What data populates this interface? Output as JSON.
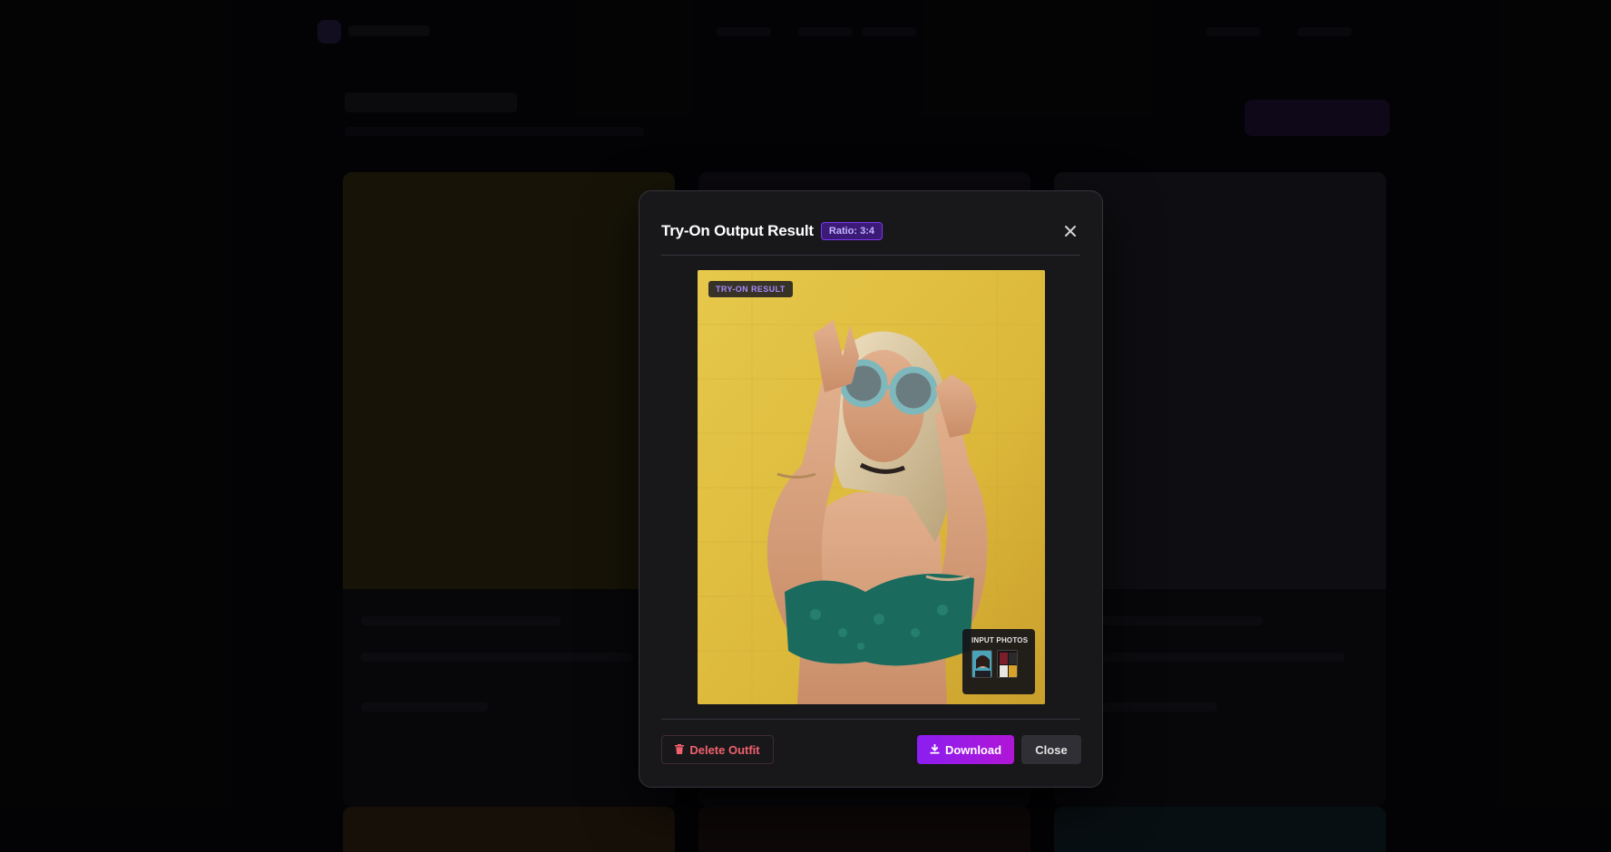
{
  "modal": {
    "title": "Try-On Output Result",
    "ratio_badge": "Ratio: 3:4",
    "close_icon": "close-icon",
    "result_tag": "TRY-ON RESULT",
    "input_photos_label": "INPUT PHOTOS",
    "buttons": {
      "delete": "Delete Outfit",
      "download": "Download",
      "close": "Close"
    }
  },
  "colors": {
    "accent": "#8b1ef0",
    "danger": "#f0616d",
    "badge_bg": "#3b1a78",
    "modal_bg": "#18181b"
  },
  "icons": [
    "close-icon",
    "trash-icon",
    "download-icon"
  ]
}
